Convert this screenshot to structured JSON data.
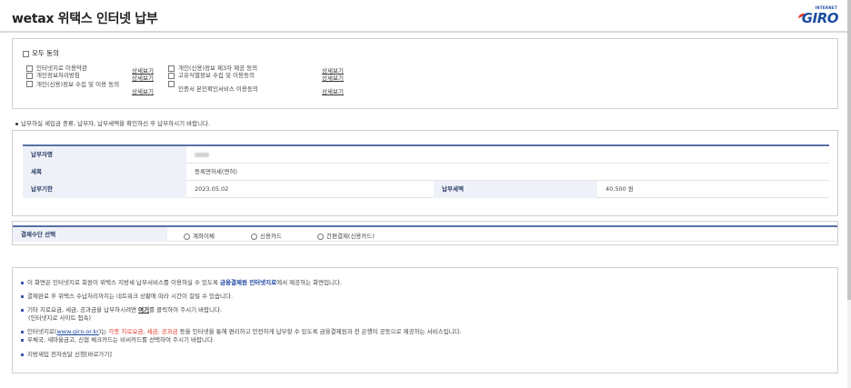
{
  "header": {
    "title": "wetax 위택스 인터넷 납부",
    "logo_small": "INTERNET",
    "logo_big": "GIRO"
  },
  "agree": {
    "all_label": "모두 동의",
    "detail_label": "상세보기",
    "items": [
      "인터넷지로 이용약관",
      "개인정보처리방침",
      "개인(신용)정보 수집 및 이용 동의",
      "개인(신용)정보 제3자 제공 동의",
      "고유식별정보 수집 및 이용동의",
      "인증서 본인확인서비스 이용동의"
    ]
  },
  "notice_top": "납부하실 세입금 종류, 납부자, 납부세액을 확인하신 후 납부하시기 바랍니다.",
  "info": {
    "payer_label": "납부자명",
    "tax_label": "세목",
    "tax_value": "등록면허세(면허)",
    "due_label": "납부기한",
    "due_value": "2023.05.02",
    "amount_label": "납부세액",
    "amount_value": "40,500 원"
  },
  "payment": {
    "label": "결제수단 선택",
    "options": [
      "계좌이체",
      "신용카드",
      "간편결제(신용카드)"
    ]
  },
  "guide": {
    "line1_a": "이 화면은 인터넷지로 회원이 위택스 지방세 납부서비스를 이용하실 수 있도록 ",
    "line1_b": "금융결제원 인터넷지로",
    "line1_c": "에서 제공하는 화면입니다.",
    "line2": "결제완료 후 위택스 수납처리까지는 네트워크 상황에 따라 시간이 걸릴 수 있습니다.",
    "line3_a": "기타 지로요금, 세금, 공과금을 납부하시려면 ",
    "line3_b": "여기",
    "line3_c": "를 클릭하여 주시기 바랍니다.",
    "line3_sub": "(인터넷지로 사이트 접속)",
    "line4_a": "인터넷지로(",
    "line4_link": "www.giro.or.kr",
    "line4_b": ")는 ",
    "line4_red": "각종 지로요금, 세금, 공과금",
    "line4_c": " 등을 인터넷을 통해 편리하고 안전하게 납부할 수 있도록 금융결제원과 전 은행이 공동으로 제공하는 서비스입니다.",
    "line5": "우체국, 새마을금고, 신협 체크카드는 비씨카드를 선택하여 주시기 바랍니다.",
    "line6": "지방세입 전자송달 신청[바로가기]"
  }
}
